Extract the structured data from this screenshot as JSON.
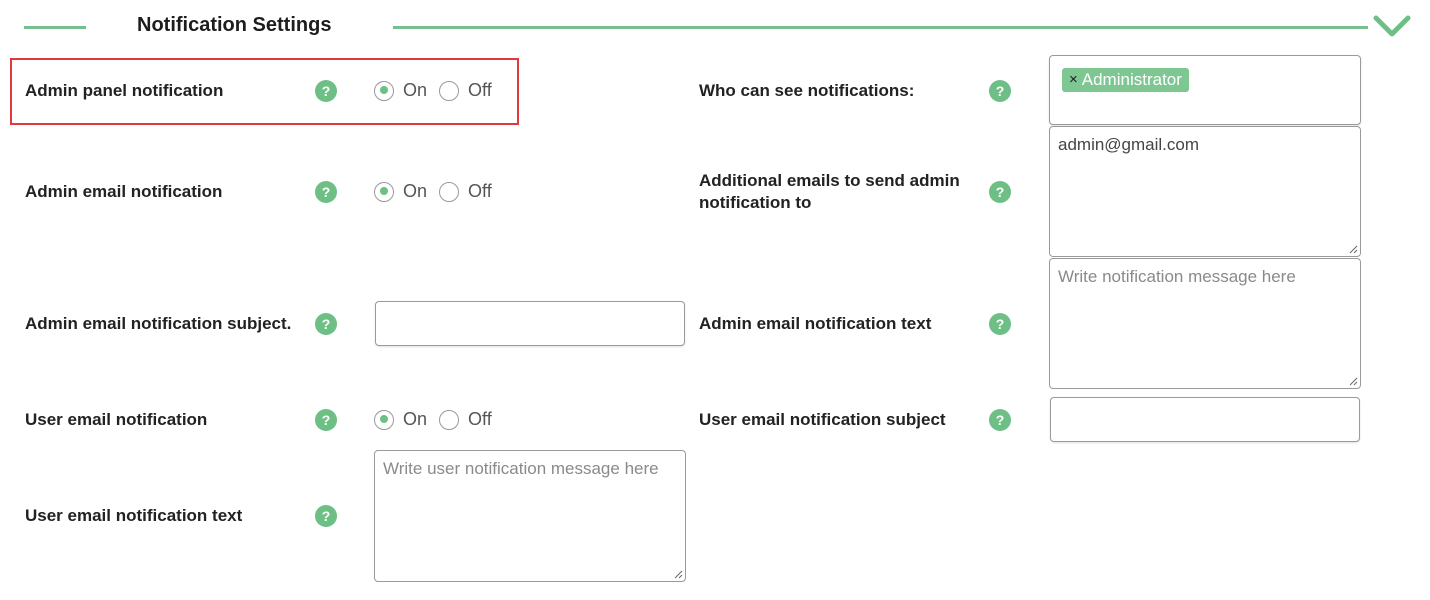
{
  "header": {
    "title": "Notification Settings"
  },
  "help_glyph": "?",
  "admin_panel": {
    "label": "Admin panel notification",
    "on": "On",
    "off": "Off",
    "selected": "On"
  },
  "admin_email": {
    "label": "Admin email notification",
    "on": "On",
    "off": "Off",
    "selected": "On"
  },
  "admin_subject": {
    "label": "Admin email notification subject.",
    "value": ""
  },
  "user_email": {
    "label": "User email notification",
    "on": "On",
    "off": "Off",
    "selected": "On"
  },
  "user_text": {
    "label": "User email notification text",
    "placeholder": "Write user notification message here"
  },
  "who_can_see": {
    "label": "Who can see notifications:",
    "tags": [
      {
        "remove": "×",
        "text": "Administrator"
      }
    ]
  },
  "additional_emails": {
    "label_line1": "Additional emails to send admin",
    "label_line2": "notification to",
    "value": "admin@gmail.com"
  },
  "admin_text": {
    "label": "Admin email notification text",
    "placeholder": "Write notification message here"
  },
  "user_subject": {
    "label": "User email notification subject",
    "value": ""
  },
  "colors": {
    "accent": "#6ebf86",
    "highlight": "#e0393e"
  },
  "icons": {
    "collapse": "chevron-down-icon",
    "help": "help-icon"
  }
}
